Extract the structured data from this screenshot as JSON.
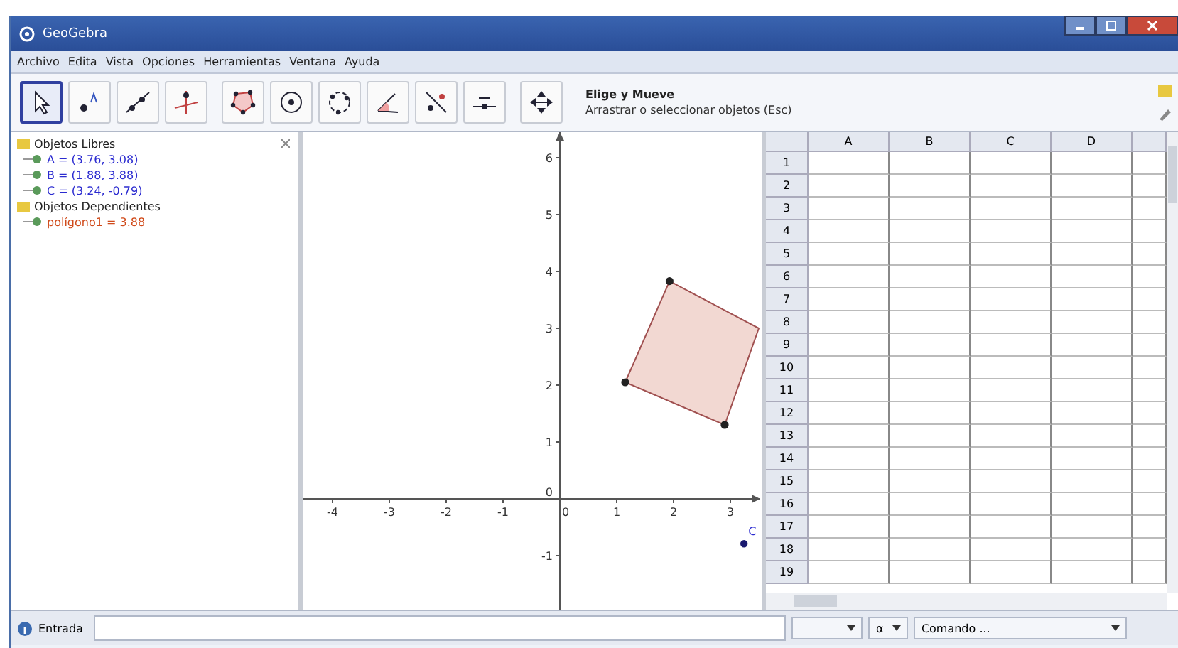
{
  "window": {
    "title": "GeoGebra"
  },
  "menu": [
    "Archivo",
    "Edita",
    "Vista",
    "Opciones",
    "Herramientas",
    "Ventana",
    "Ayuda"
  ],
  "tools": [
    {
      "kind": "move",
      "selected": true
    },
    {
      "kind": "point",
      "selected": false
    },
    {
      "kind": "line",
      "selected": false
    },
    {
      "kind": "perpendicular",
      "selected": false
    },
    {
      "kind": "polygon",
      "selected": false
    },
    {
      "kind": "circle",
      "selected": false
    },
    {
      "kind": "circle3",
      "selected": false
    },
    {
      "kind": "angle",
      "selected": false
    },
    {
      "kind": "reflect",
      "selected": false
    },
    {
      "kind": "slider",
      "selected": false
    },
    {
      "kind": "pan",
      "selected": false
    }
  ],
  "tool_help": {
    "title": "Elige y Mueve",
    "description": "Arrastrar o seleccionar objetos (Esc)"
  },
  "algebra": [
    {
      "label": "Objetos Libres",
      "expanded": true,
      "children": [
        {
          "label": "A = (3.76, 3.08)",
          "color": "#2b2bd0"
        },
        {
          "label": "B = (1.88, 3.88)",
          "color": "#2b2bd0"
        },
        {
          "label": "C = (3.24, -0.79)",
          "color": "#2b2bd0"
        }
      ]
    },
    {
      "label": "Objetos Dependientes",
      "expanded": true,
      "children": [
        {
          "label": "polígono1 = 3.88",
          "color": "#d04a1a"
        }
      ]
    }
  ],
  "graphics": {
    "x_ticks": [
      "-4",
      "-3",
      "-2",
      "-1",
      "0",
      "1",
      "2",
      "3"
    ],
    "y_ticks": [
      "6",
      "5",
      "4",
      "3",
      "2",
      "1",
      "0",
      "-1"
    ],
    "point_label": "C"
  },
  "spreadsheet": {
    "columns": [
      "A",
      "B",
      "C",
      "D"
    ],
    "rows": [
      "1",
      "2",
      "3",
      "4",
      "5",
      "6",
      "7",
      "8",
      "9",
      "10",
      "11",
      "12",
      "13",
      "14",
      "15",
      "16",
      "17",
      "18",
      "19"
    ]
  },
  "input_bar": {
    "label": "Entrada",
    "symbol": "α",
    "command": "Comando ..."
  }
}
